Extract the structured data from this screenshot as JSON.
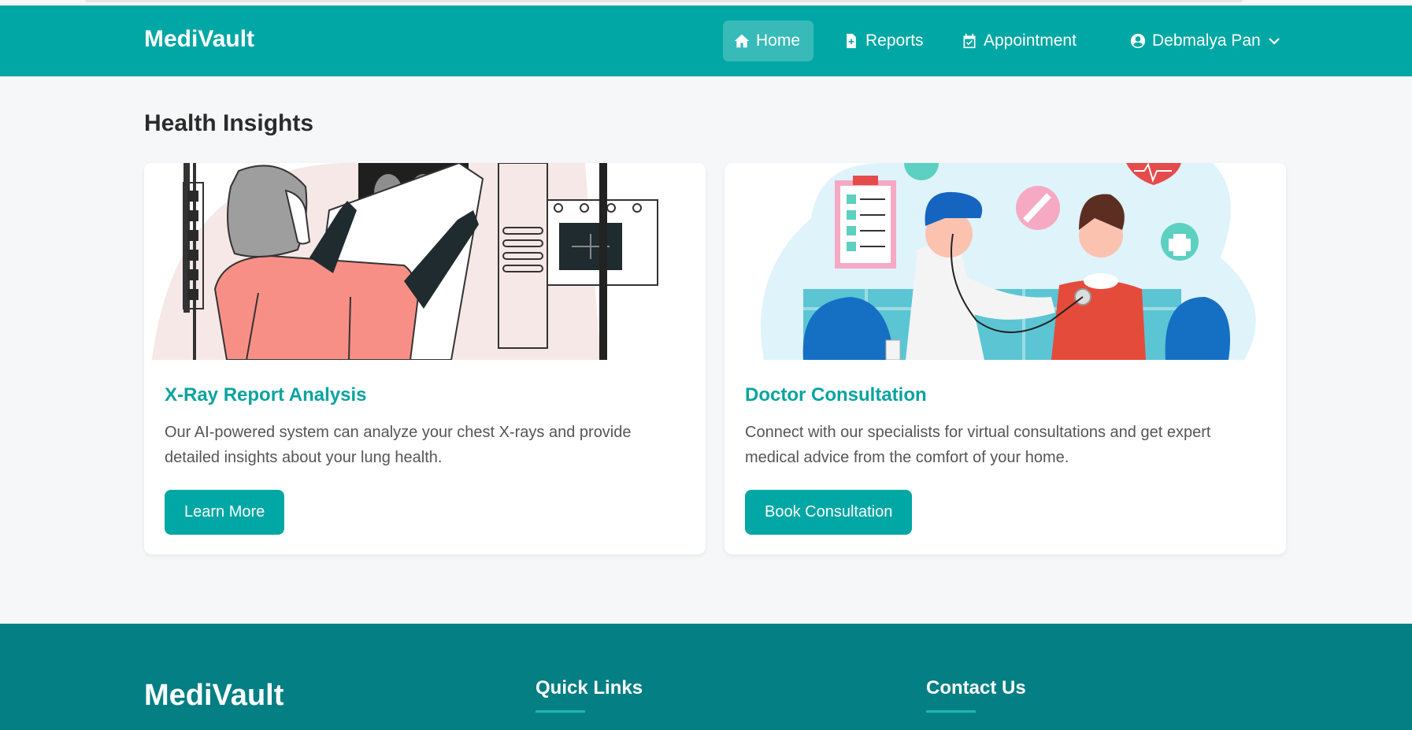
{
  "nav": {
    "brand": "MediVault",
    "links": [
      {
        "label": "Home",
        "icon": "home-icon",
        "active": true
      },
      {
        "label": "Reports",
        "icon": "file-medical-icon",
        "active": false
      },
      {
        "label": "Appointment",
        "icon": "calendar-check-icon",
        "active": false
      }
    ],
    "user": {
      "name": "Debmalya Pan",
      "icon": "user-circle-icon",
      "caret": "chevron-down-icon"
    }
  },
  "main": {
    "title": "Health Insights",
    "cards": [
      {
        "image": "xray-illustration",
        "title": "X-Ray Report Analysis",
        "text": "Our AI-powered system can analyze your chest X-rays and provide detailed insights about your lung health.",
        "button": "Learn More"
      },
      {
        "image": "doctor-consultation-illustration",
        "title": "Doctor Consultation",
        "text": "Connect with our specialists for virtual consultations and get expert medical advice from the comfort of your home.",
        "button": "Book Consultation"
      }
    ]
  },
  "footer": {
    "brand": "MediVault",
    "quick_links": "Quick Links",
    "contact": "Contact Us"
  },
  "colors": {
    "primary": "#00a7a4",
    "footer": "#047f84",
    "accent_text": "#0aa3a0",
    "background": "#f6f7f9"
  }
}
